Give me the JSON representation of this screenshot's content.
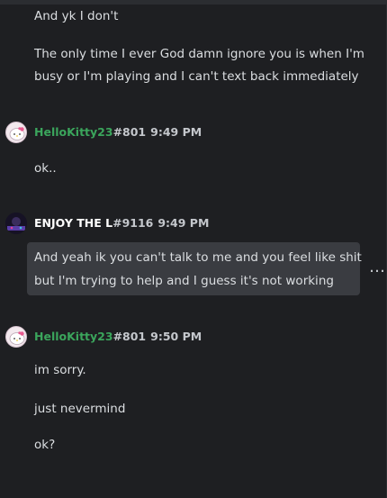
{
  "colors": {
    "background": "#1e1f22",
    "hellokitty_name": "#3ba55c",
    "enjoy_name": "#ffffff",
    "highlight_bg": "#3a3c41"
  },
  "messages_top": [
    "And yk I don't",
    "The only time I ever God damn ignore you is when I'm",
    "busy or I'm playing and I can't text back immediately"
  ],
  "groups": [
    {
      "username": "HelloKitty23",
      "tag": "#801",
      "time": "9:49 PM",
      "avatar": "hello-kitty-avatar",
      "lines": [
        "ok.."
      ]
    },
    {
      "username": "ENJOY THE L",
      "tag": "#9116",
      "time": "9:49 PM",
      "avatar": "dark-avatar",
      "lines": [
        "And yeah ik you can't talk to me and you feel like shit",
        "but I'm trying to help and I guess it's not working"
      ]
    },
    {
      "username": "HelloKitty23",
      "tag": "#801",
      "time": "9:50 PM",
      "avatar": "hello-kitty-avatar",
      "lines": [
        "im sorry.",
        "just nevermind",
        "ok?"
      ]
    }
  ],
  "more_icon": "more-options-icon",
  "more_glyph": "…"
}
